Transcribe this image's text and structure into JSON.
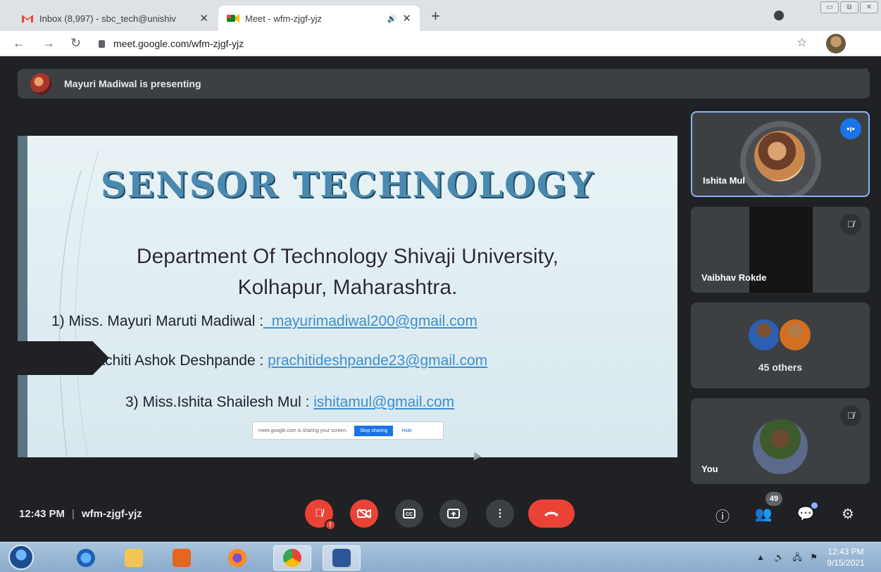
{
  "browser": {
    "tabs": [
      {
        "title": "Inbox (8,997) - sbc_tech@unishiv",
        "favicon": "gmail-icon",
        "active": false
      },
      {
        "title": "Meet - wfm-zjgf-yjz",
        "favicon": "meet-icon",
        "active": true,
        "playing_audio": true
      }
    ],
    "new_tab": "+",
    "url": "meet.google.com/wfm-zjgf-yjz"
  },
  "meet": {
    "presenting_banner": "Mayuri Madiwal is presenting",
    "slide": {
      "title": "SENSOR TECHNOLOGY",
      "department_line1": "Department Of Technology Shivaji University,",
      "department_line2": "Kolhapur, Maharashtra.",
      "members": [
        {
          "label": "1)  Miss. Mayuri Maruti Madiwal :",
          "email": "_mayurimadiwal200@gmail.com"
        },
        {
          "label": "2) Miss. Prachiti Ashok Deshpande : ",
          "email": "prachitideshpande23@gmail.com"
        },
        {
          "label": "3) Miss.Ishita Shailesh Mul : ",
          "email": "ishitamul@gmail.com"
        }
      ],
      "share_notice": {
        "text": "meet.google.com is sharing your screen.",
        "stop": "Stop sharing",
        "hide": "Hide"
      }
    },
    "participants": [
      {
        "name": "Ishita Mul",
        "speaking": true
      },
      {
        "name": "Vaibhav Rokde",
        "muted": true
      },
      {
        "name": "45 others"
      },
      {
        "name": "You",
        "muted": true
      }
    ],
    "controls": {
      "time": "12:43 PM",
      "separator": "|",
      "meeting_code": "wfm-zjgf-yjz",
      "participants_count": "49"
    }
  },
  "taskbar": {
    "clock_time": "12:43 PM",
    "clock_date": "9/15/2021"
  },
  "colors": {
    "meet_bg": "#202124",
    "tile_bg": "#3c4043",
    "danger": "#ea4335",
    "accent": "#1a73e8",
    "speaking_border": "#8ab4f8"
  }
}
